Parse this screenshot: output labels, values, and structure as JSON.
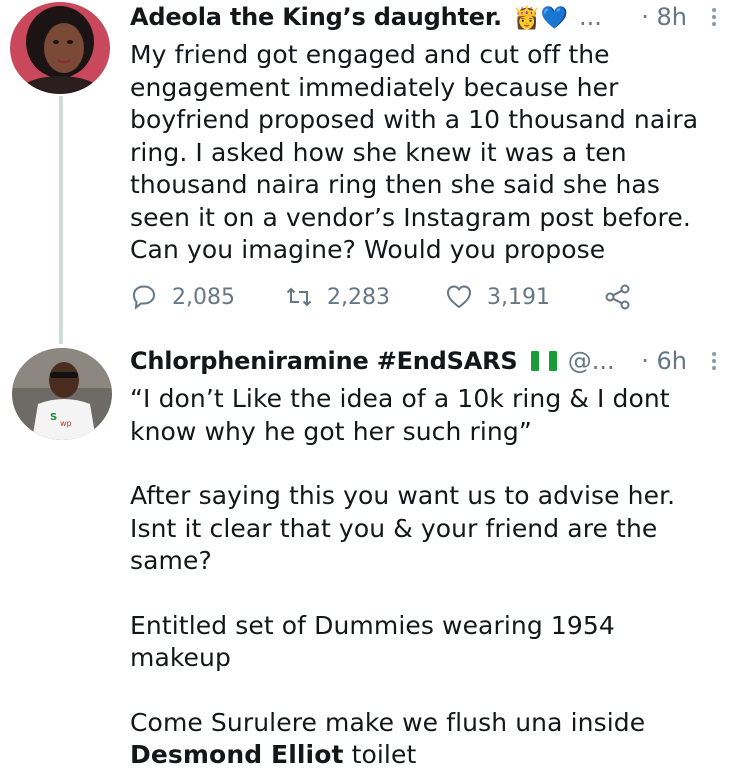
{
  "tweets": [
    {
      "author": "Adeola the King’s daughter.",
      "badges": "👸💙",
      "handle": "...",
      "time": "· 8h",
      "text": "My friend got engaged and cut off the engagement immediately because her boyfriend proposed with a 10 thousand naira ring. I asked how she knew it was a ten thousand naira ring then she said she has seen it on a vendor’s Instagram post before. Can you imagine? Would you propose",
      "replies": "2,085",
      "retweets": "2,283",
      "likes": "3,191"
    },
    {
      "author": "Chlorpheniramine #EndSARS",
      "flag": "🇳🇬",
      "handle": "@...",
      "time": "· 6h",
      "paragraphs": [
        "“I don’t Like the idea of a 10k ring & I dont know why he got her such ring”",
        "After saying this you want us to advise her. Isnt it clear that you & your friend are the same?",
        "Entitled set of Dummies wearing 1954 makeup"
      ],
      "last_line_prefix": "Come Surulere make we flush una inside",
      "last_line_bold": "Desmond Elliot",
      "last_line_suffix": " toilet"
    }
  ],
  "icons": {
    "reply": "reply-icon",
    "retweet": "retweet-icon",
    "like": "like-icon",
    "share": "share-icon",
    "more": "more-options-icon"
  },
  "colors": {
    "muted": "#657786",
    "thread_line": "#cfd9de",
    "text": "#14171a"
  }
}
